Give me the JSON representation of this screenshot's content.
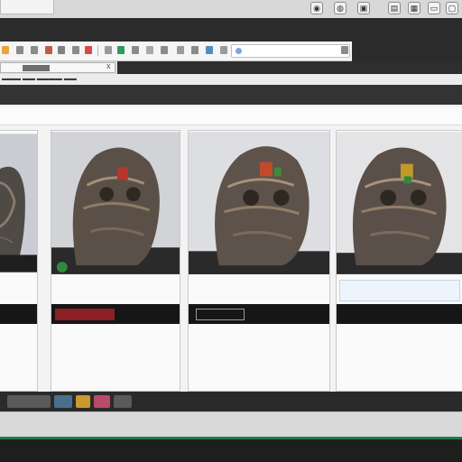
{
  "window": {
    "controls": [
      {
        "name": "refresh-icon",
        "glyph": "◉"
      },
      {
        "name": "shield-icon",
        "glyph": "◍"
      },
      {
        "name": "document-icon",
        "glyph": "▣"
      },
      {
        "name": "folder-icon",
        "glyph": "▤"
      },
      {
        "name": "tools-icon",
        "glyph": "▦"
      },
      {
        "name": "minimize-icon",
        "glyph": "▭"
      },
      {
        "name": "close-icon",
        "glyph": "▢"
      }
    ]
  },
  "toolbar": {
    "icons": [
      {
        "name": "home-icon",
        "color": "#e8a53c"
      },
      {
        "name": "back-icon",
        "color": "#8b8b8b"
      },
      {
        "name": "forward-icon",
        "color": "#8b8b8b"
      },
      {
        "name": "mail-icon",
        "color": "#c05a4a"
      },
      {
        "name": "print-icon",
        "color": "#7f7f7f"
      },
      {
        "name": "edit-icon",
        "color": "#8b8b8b"
      },
      {
        "name": "flag-icon",
        "color": "#d64a4a"
      },
      {
        "name": "bookmark-icon",
        "color": "#9a9a9a"
      },
      {
        "name": "globe-icon",
        "color": "#2f9b5a"
      },
      {
        "name": "lock-icon",
        "color": "#8b8b8b"
      },
      {
        "name": "star-icon",
        "color": "#a8a8a8"
      },
      {
        "name": "history-icon",
        "color": "#8b8b8b"
      },
      {
        "name": "settings-icon",
        "color": "#9a9a9a"
      },
      {
        "name": "download-icon",
        "color": "#8b8b8b"
      },
      {
        "name": "share-icon",
        "color": "#4d8fc4"
      },
      {
        "name": "gear-icon",
        "color": "#9a9a9a"
      },
      {
        "name": "menu-icon",
        "color": "#8b8b8b"
      }
    ]
  },
  "address": {
    "close_glyph": "x"
  },
  "breadcrumb": {
    "text": "▬▬▬ ▬▬ ▬▬▬▬ ▬▬"
  },
  "page": {
    "heading_accent": "",
    "heading_rest": ""
  },
  "cards": [
    {
      "caption1": "",
      "caption2": "",
      "button": "",
      "desc": ""
    },
    {
      "caption1": "",
      "caption2": "",
      "button": "",
      "desc": ""
    },
    {
      "caption1": "",
      "caption2": "",
      "button": "",
      "desc": ""
    },
    {
      "caption1": "",
      "caption2": "",
      "button": "",
      "desc": ""
    }
  ],
  "taskbar": {
    "items": [
      {
        "name": "taskbar-app-1",
        "color": "#5a5a5a"
      },
      {
        "name": "taskbar-app-2",
        "color": "#4a6f8c"
      },
      {
        "name": "taskbar-app-3",
        "color": "#c99a2e"
      },
      {
        "name": "taskbar-app-4",
        "color": "#b94a6a"
      }
    ]
  },
  "colors": {
    "accent": "#1f6fb4",
    "status_green": "#1d7a4a",
    "card_button": "#8b1f24"
  }
}
